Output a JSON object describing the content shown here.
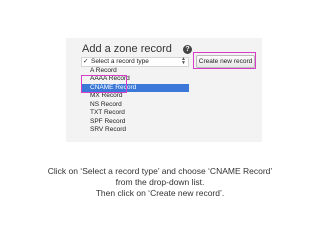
{
  "panel": {
    "title": "Add a zone record",
    "help_icon": "?"
  },
  "dropdown": {
    "check_mark": "✓",
    "arrows": "▲▼",
    "options": [
      "Select a record type",
      "A Record",
      "AAAA Record",
      "CNAME Record",
      "MX Record",
      "NS Record",
      "TXT Record",
      "SPF Record",
      "SRV Record"
    ],
    "selected": "CNAME Record"
  },
  "button": {
    "create_label": "Create new record"
  },
  "instructions": {
    "line1": "Click on ‘Select a record type’ and choose ‘CNAME Record’",
    "line2": "from the drop-down list.",
    "line3": "Then click on ‘Create new record’."
  },
  "colors": {
    "highlight": "#d63ec9",
    "selection": "#3b78d8"
  }
}
